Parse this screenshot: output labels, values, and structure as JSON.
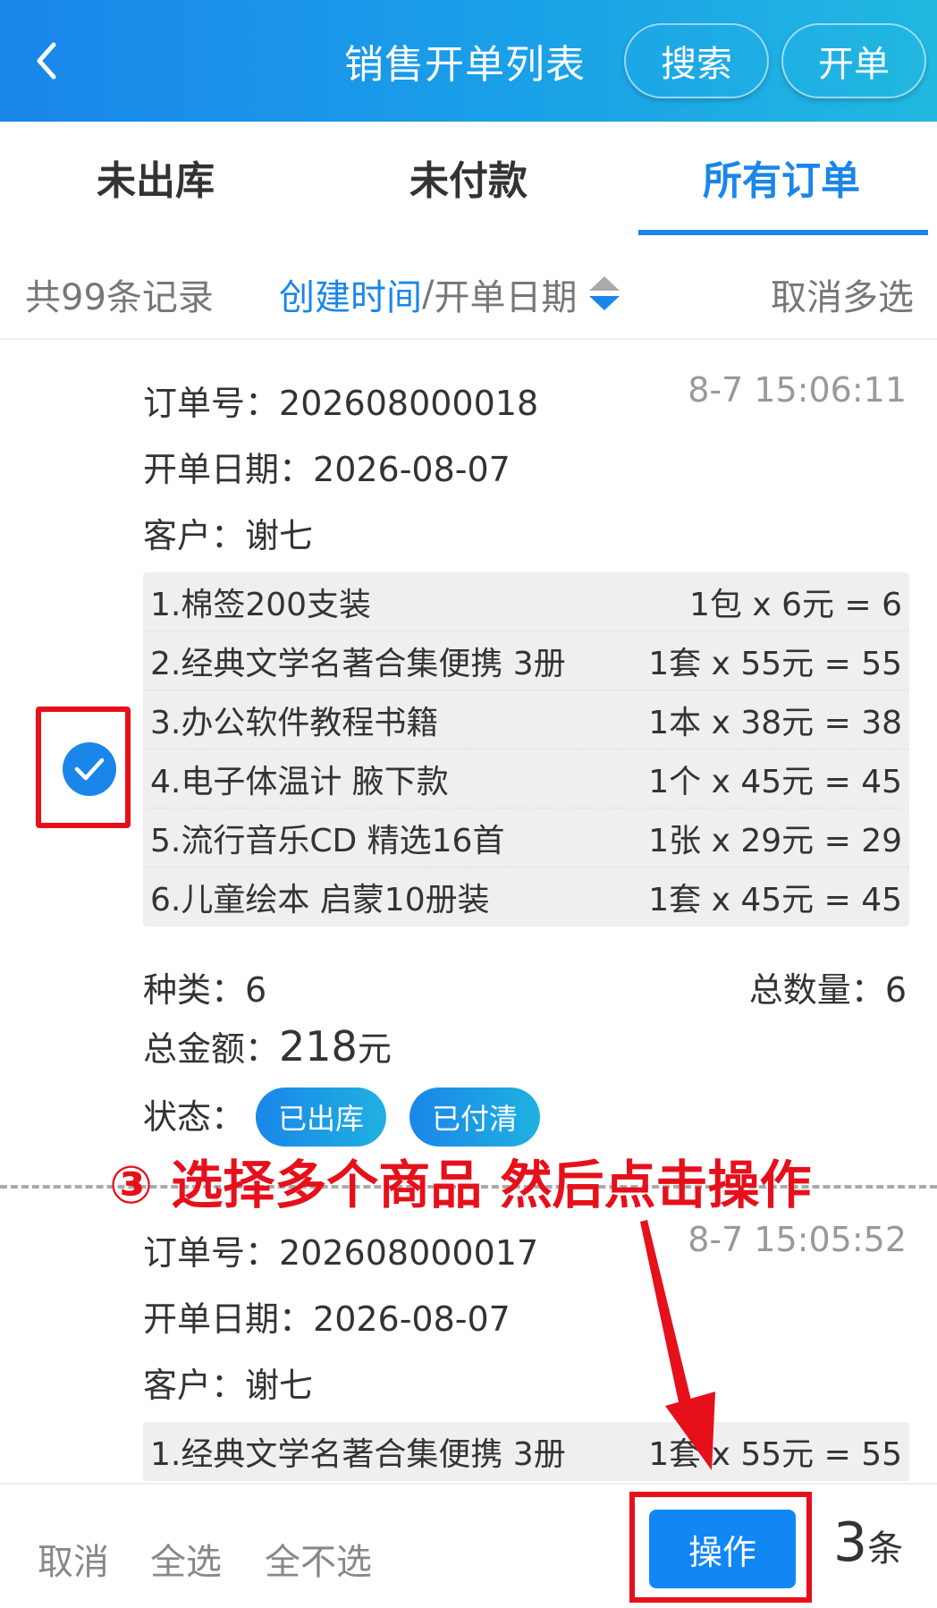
{
  "header": {
    "title": "销售开单列表",
    "search_label": "搜索",
    "create_label": "开单"
  },
  "tabs": [
    {
      "label": "未出库",
      "active": false
    },
    {
      "label": "未付款",
      "active": false
    },
    {
      "label": "所有订单",
      "active": true
    }
  ],
  "filter": {
    "record_count": "共99条记录",
    "sort_active": "创建时间",
    "sort_separator": "/",
    "sort_inactive": "开单日期",
    "cancel_multi": "取消多选"
  },
  "orders": [
    {
      "selected": true,
      "order_no_label": "订单号：",
      "order_no": "202608000018",
      "time": "8-7 15:06:11",
      "date_label": "开单日期：",
      "date": "2026-08-07",
      "customer_label": "客户：",
      "customer": "谢七",
      "items": [
        {
          "name": "1.棉签200支装",
          "calc": "1包 x 6元 = 6"
        },
        {
          "name": "2.经典文学名著合集便携 3册",
          "calc": "1套 x 55元 = 55"
        },
        {
          "name": "3.办公软件教程书籍",
          "calc": "1本 x 38元 = 38"
        },
        {
          "name": "4.电子体温计 腋下款",
          "calc": "1个 x 45元 = 45"
        },
        {
          "name": "5.流行音乐CD 精选16首",
          "calc": "1张 x 29元 = 29"
        },
        {
          "name": "6.儿童绘本 启蒙10册装",
          "calc": "1套 x 45元 = 45"
        }
      ],
      "kinds_label": "种类：",
      "kinds": "6",
      "qty_label": "总数量：",
      "qty": "6",
      "total_label": "总金额：",
      "total": "218",
      "total_unit": "元",
      "status_label": "状态：",
      "status": [
        "已出库",
        "已付清"
      ]
    },
    {
      "selected": false,
      "order_no_label": "订单号：",
      "order_no": "202608000017",
      "time": "8-7 15:05:52",
      "date_label": "开单日期：",
      "date": "2026-08-07",
      "customer_label": "客户：",
      "customer": "谢七",
      "items": [
        {
          "name": "1.经典文学名著合集便携 3册",
          "calc": "1套 x 55元 = 55"
        }
      ]
    }
  ],
  "annotation": "③ 选择多个商品 然后点击操作",
  "bottom": {
    "cancel": "取消",
    "select_all": "全选",
    "select_none": "全不选",
    "action": "操作",
    "count": "3",
    "count_unit": "条"
  },
  "colors": {
    "accent": "#1a86ea",
    "annotation_red": "#e6101b"
  }
}
